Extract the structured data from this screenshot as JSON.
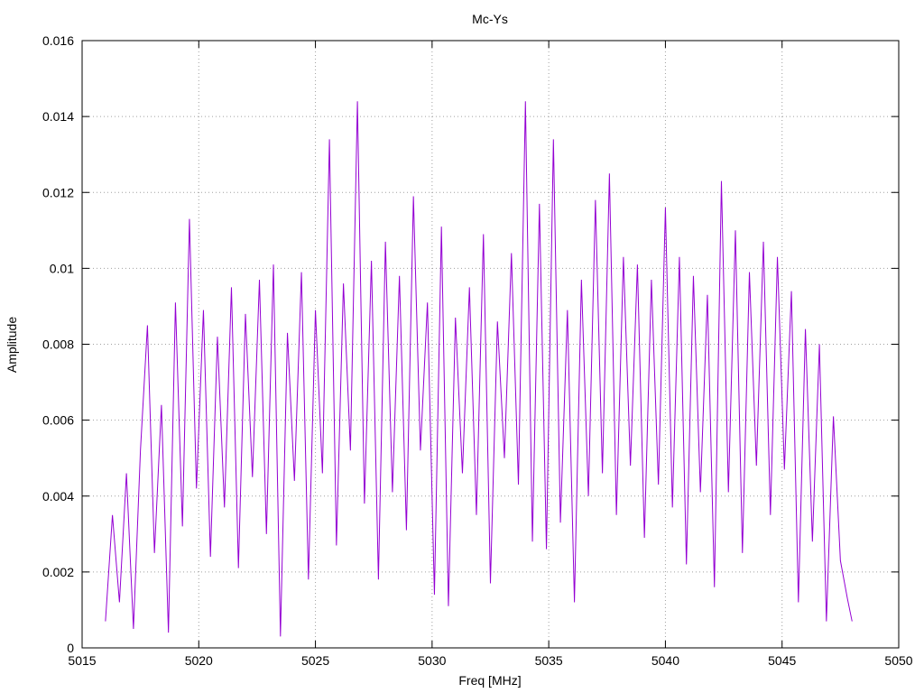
{
  "chart_data": {
    "type": "line",
    "title": "Mc-Ys",
    "xlabel": "Freq [MHz]",
    "ylabel": "Amplitude",
    "xlim": [
      5015,
      5050
    ],
    "ylim": [
      0,
      0.016
    ],
    "x_ticks": [
      5015,
      5020,
      5025,
      5030,
      5035,
      5040,
      5045,
      5050
    ],
    "y_ticks": [
      0,
      0.002,
      0.004,
      0.006,
      0.008,
      0.01,
      0.012,
      0.014,
      0.016
    ],
    "x_tick_labels": [
      "5015",
      "5020",
      "5025",
      "5030",
      "5035",
      "5040",
      "5045",
      "5050"
    ],
    "y_tick_labels": [
      "0",
      "0.002",
      "0.004",
      "0.006",
      "0.008",
      "0.01",
      "0.012",
      "0.014",
      "0.016"
    ],
    "grid": true,
    "series": [
      {
        "color": "#9400d3",
        "x": [
          5016.0,
          5016.3,
          5016.6,
          5016.9,
          5017.2,
          5017.5,
          5017.8,
          5018.1,
          5018.4,
          5018.7,
          5019.0,
          5019.3,
          5019.6,
          5019.9,
          5020.2,
          5020.5,
          5020.8,
          5021.1,
          5021.4,
          5021.7,
          5022.0,
          5022.3,
          5022.6,
          5022.9,
          5023.2,
          5023.5,
          5023.8,
          5024.1,
          5024.4,
          5024.7,
          5025.0,
          5025.3,
          5025.6,
          5025.9,
          5026.2,
          5026.5,
          5026.8,
          5027.1,
          5027.4,
          5027.7,
          5028.0,
          5028.3,
          5028.6,
          5028.9,
          5029.2,
          5029.5,
          5029.8,
          5030.1,
          5030.4,
          5030.7,
          5031.0,
          5031.3,
          5031.6,
          5031.9,
          5032.2,
          5032.5,
          5032.8,
          5033.1,
          5033.4,
          5033.7,
          5034.0,
          5034.3,
          5034.6,
          5034.9,
          5035.2,
          5035.5,
          5035.8,
          5036.1,
          5036.4,
          5036.7,
          5037.0,
          5037.3,
          5037.6,
          5037.9,
          5038.2,
          5038.5,
          5038.8,
          5039.1,
          5039.4,
          5039.7,
          5040.0,
          5040.3,
          5040.6,
          5040.9,
          5041.2,
          5041.5,
          5041.8,
          5042.1,
          5042.4,
          5042.7,
          5043.0,
          5043.3,
          5043.6,
          5043.9,
          5044.2,
          5044.5,
          5044.8,
          5045.1,
          5045.4,
          5045.7,
          5046.0,
          5046.3,
          5046.6,
          5046.9,
          5047.2,
          5047.5,
          5047.8,
          5048.0
        ],
        "y": [
          0.0007,
          0.0035,
          0.0012,
          0.0046,
          0.0005,
          0.0052,
          0.0085,
          0.0025,
          0.0064,
          0.0004,
          0.0091,
          0.0032,
          0.0113,
          0.0042,
          0.0089,
          0.0024,
          0.0082,
          0.0037,
          0.0095,
          0.0021,
          0.0088,
          0.0045,
          0.0097,
          0.003,
          0.0101,
          0.0003,
          0.0083,
          0.0044,
          0.0099,
          0.0018,
          0.0089,
          0.0046,
          0.0134,
          0.0027,
          0.0096,
          0.0052,
          0.0144,
          0.0038,
          0.0102,
          0.0018,
          0.0107,
          0.0041,
          0.0098,
          0.0031,
          0.0119,
          0.0052,
          0.0091,
          0.0014,
          0.0111,
          0.0011,
          0.0087,
          0.0046,
          0.0095,
          0.0035,
          0.0109,
          0.0017,
          0.0086,
          0.005,
          0.0104,
          0.0043,
          0.0144,
          0.0028,
          0.0117,
          0.0026,
          0.0134,
          0.0033,
          0.0089,
          0.0012,
          0.0097,
          0.004,
          0.0118,
          0.0046,
          0.0125,
          0.0035,
          0.0103,
          0.0048,
          0.0101,
          0.0029,
          0.0097,
          0.0043,
          0.0116,
          0.0037,
          0.0103,
          0.0022,
          0.0098,
          0.0041,
          0.0093,
          0.0016,
          0.0123,
          0.0041,
          0.011,
          0.0025,
          0.0099,
          0.0048,
          0.0107,
          0.0035,
          0.0103,
          0.0047,
          0.0094,
          0.0012,
          0.0084,
          0.0028,
          0.008,
          0.0007,
          0.0061,
          0.0023,
          0.0013,
          0.0007
        ]
      }
    ]
  }
}
